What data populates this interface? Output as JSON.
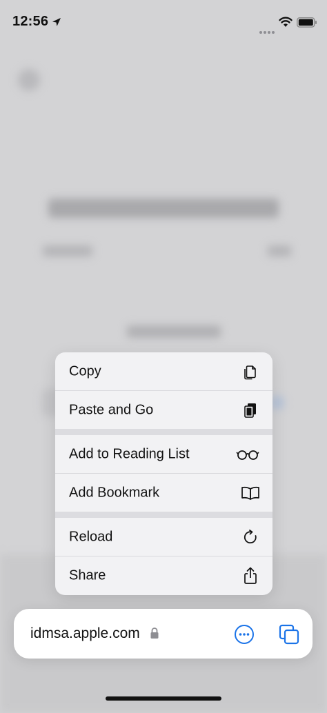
{
  "status_bar": {
    "time": "12:56",
    "icons": [
      "location-arrow-icon",
      "signal-dots-icon",
      "wifi-icon",
      "battery-icon"
    ]
  },
  "context_menu": {
    "groups": [
      [
        {
          "label": "Copy",
          "icon": "copy-icon"
        },
        {
          "label": "Paste and Go",
          "icon": "paste-icon"
        }
      ],
      [
        {
          "label": "Add to Reading List",
          "icon": "glasses-icon"
        },
        {
          "label": "Add Bookmark",
          "icon": "book-icon"
        }
      ],
      [
        {
          "label": "Reload",
          "icon": "reload-icon"
        },
        {
          "label": "Share",
          "icon": "share-icon"
        }
      ]
    ]
  },
  "address_bar": {
    "url": "idmsa.apple.com",
    "icons": [
      "lock-icon",
      "more-options-icon",
      "tabs-icon"
    ]
  },
  "colors": {
    "accent": "#1a73e8",
    "menu_bg": "#f2f2f4",
    "backdrop": "#d3d3d5"
  }
}
